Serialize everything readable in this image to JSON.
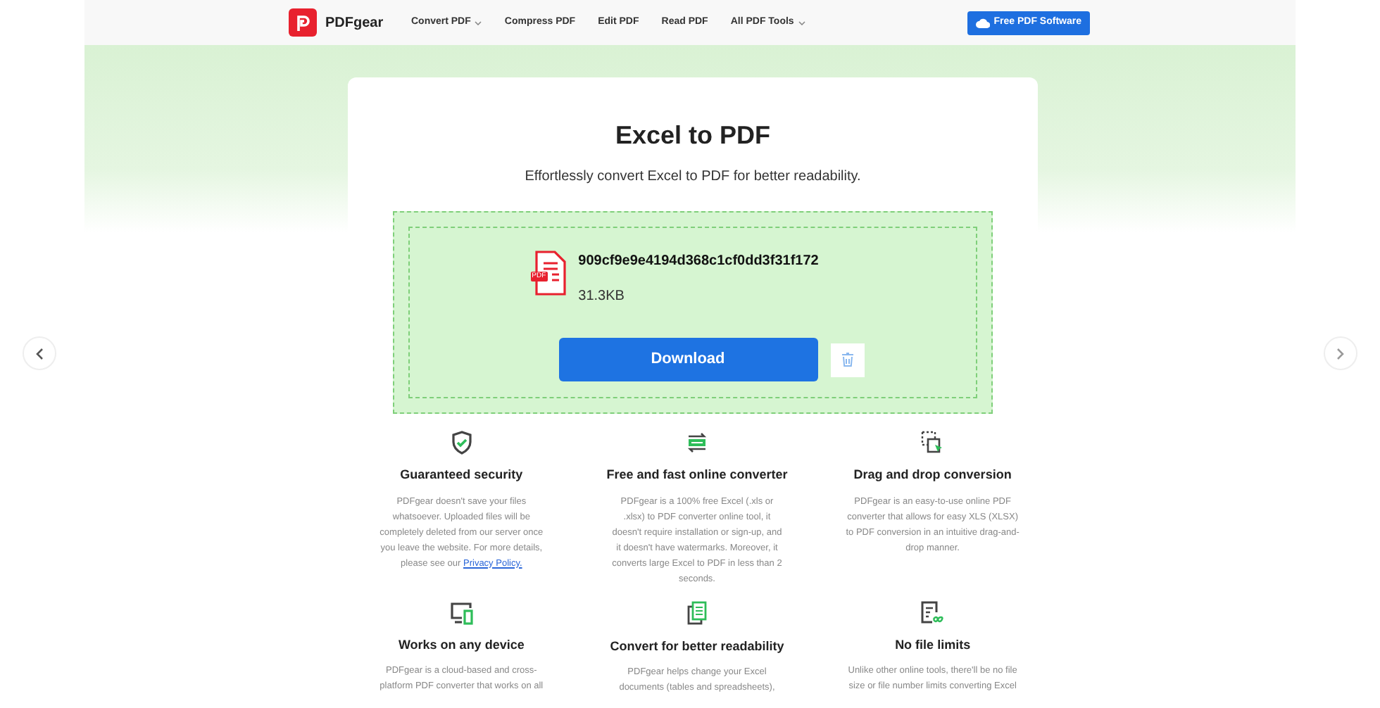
{
  "nav": {
    "brand": "PDFgear",
    "links": [
      {
        "label": "Convert PDF",
        "dropdown": true
      },
      {
        "label": "Compress PDF",
        "dropdown": false
      },
      {
        "label": "Edit PDF",
        "dropdown": false
      },
      {
        "label": "Read PDF",
        "dropdown": false
      },
      {
        "label": "All PDF Tools",
        "dropdown": true
      }
    ],
    "cta": "Free PDF Software"
  },
  "hero": {
    "title": "Excel to PDF",
    "subtitle": "Effortlessly convert Excel to PDF for better readability."
  },
  "file": {
    "badge": "PDF",
    "name": "909cf9e9e4194d368c1cf0dd3f31f172",
    "size": "31.3KB",
    "download": "Download"
  },
  "features": [
    {
      "title": "Guaranteed security",
      "description": "PDFgear doesn't save your files whatsoever. Uploaded files will be completely deleted from our server once you leave the website. For more details, please see our",
      "link": "Privacy Policy."
    },
    {
      "title": "Free and fast online converter",
      "description": "PDFgear is a 100% free Excel (.xls or .xlsx) to PDF converter online tool, it doesn't require installation or sign-up, and it doesn't have watermarks. Moreover, it converts large Excel to PDF in less than 2 seconds."
    },
    {
      "title": "Drag and drop conversion",
      "description": "PDFgear is an easy-to-use online PDF converter that allows for easy XLS (XLSX) to PDF conversion in an intuitive drag-and-drop manner."
    },
    {
      "title": "Works on any device",
      "description": "PDFgear is a cloud-based and cross-platform PDF converter that works on all"
    },
    {
      "title": "Convert for better readability",
      "description": "PDFgear helps change your Excel documents (tables and spreadsheets),"
    },
    {
      "title": "No file limits",
      "description": "Unlike other online tools, there'll be no file size or file number limits converting Excel"
    }
  ]
}
